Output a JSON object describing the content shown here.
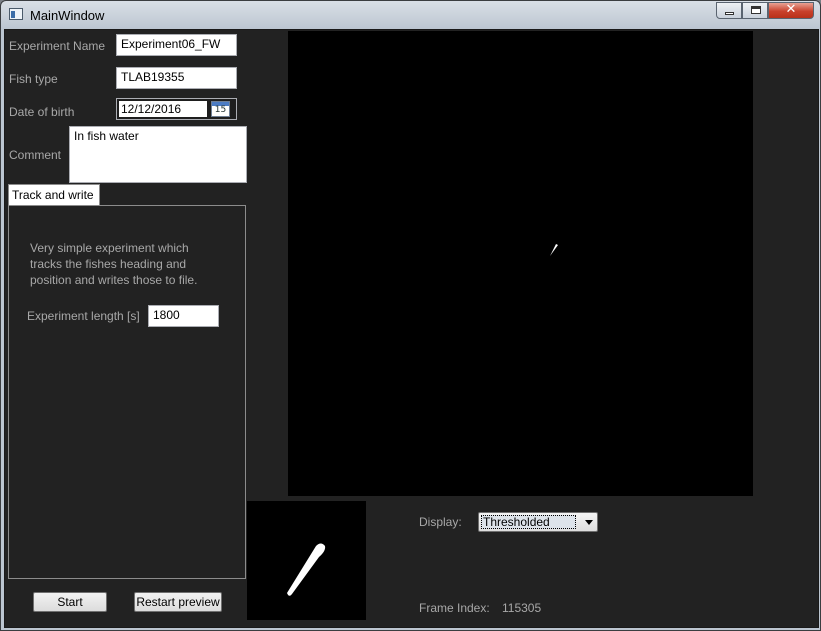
{
  "window": {
    "title": "MainWindow",
    "icon": "app-window-icon",
    "controls": {
      "minimize": "minimize-icon",
      "maximize": "maximize-icon",
      "close_glyph": "✕"
    }
  },
  "form": {
    "experiment_name": {
      "label": "Experiment Name",
      "value": "Experiment06_FW"
    },
    "fish_type": {
      "label": "Fish type",
      "value": "TLAB19355"
    },
    "date_of_birth": {
      "label": "Date of birth",
      "value": "12/12/2016",
      "calendar_day": "15"
    },
    "comment": {
      "label": "Comment",
      "value": "In fish water"
    }
  },
  "tab": {
    "label": "Track and write",
    "description": "Very simple experiment which tracks the fishes heading and position and writes those to file.",
    "experiment_length": {
      "label": "Experiment length [s]",
      "value": "1800"
    }
  },
  "buttons": {
    "start": "Start",
    "restart_preview": "Restart preview"
  },
  "display": {
    "label": "Display:",
    "selected": "Thresholded"
  },
  "frame": {
    "label": "Frame Index:",
    "value": "115305"
  },
  "colors": {
    "background": "#222222",
    "label_text": "#a8a8a8",
    "preview": "#000000"
  }
}
